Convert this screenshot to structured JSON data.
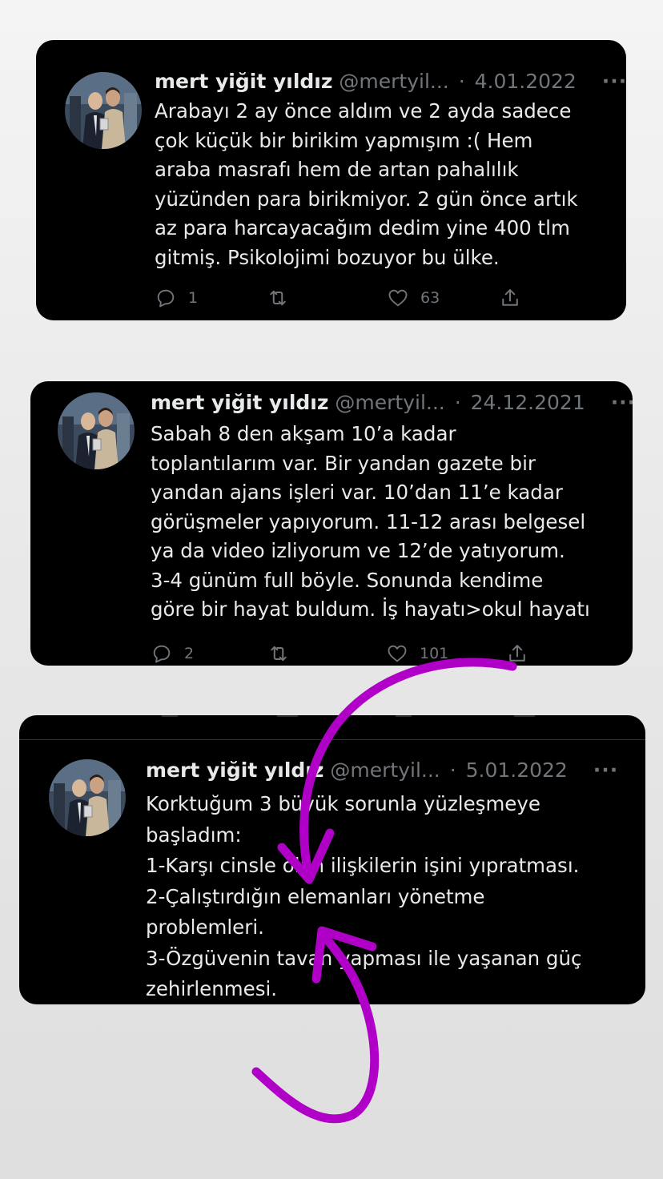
{
  "tweets": [
    {
      "name": "mert yiğit yıldız",
      "handle": "@mertyil...",
      "date": "4.01.2022",
      "more": "···",
      "lines": [
        "Arabayı 2 ay önce aldım ve 2 ayda sadece",
        "çok küçük bir birikim yapmışım :( Hem",
        "araba masrafı hem de artan pahalılık",
        "yüzünden para birikmiyor. 2 gün önce artık",
        "az para harcayacağım dedim yine 400 tlm",
        "gitmiş. Psikolojimi bozuyor bu ülke."
      ],
      "replies": "1",
      "likes": "63"
    },
    {
      "name": "mert yiğit yıldız",
      "handle": "@mertyil...",
      "date": "24.12.2021",
      "more": "···",
      "lines": [
        "Sabah 8 den akşam 10’a kadar",
        "toplantılarım var. Bir yandan gazete bir",
        "yandan ajans işleri var. 10’dan 11’e kadar",
        "görüşmeler yapıyorum. 11-12 arası belgesel",
        "ya da video izliyorum ve 12’de yatıyorum.",
        "3-4 günüm full böyle. Sonunda kendime",
        "göre bir hayat buldum. İş hayatı>okul hayatı"
      ],
      "replies": "2",
      "likes": "101"
    },
    {
      "name": "mert yiğit yıldız",
      "handle": "@mertyil...",
      "date": "5.01.2022",
      "more": "···",
      "lines": [
        "Korktuğum 3 büyük sorunla yüzleşmeye",
        "başladım:",
        "1-Karşı cinsle olan ilişkilerin işini yıpratması.",
        "2-Çalıştırdığın elemanları yönetme",
        "problemleri.",
        "3-Özgüvenin tavan yapması ile yaşanan güç",
        "zehirlenmesi."
      ]
    }
  ],
  "icons": {
    "reply": "speech-bubble",
    "retweet": "retweet-arrows",
    "like": "heart",
    "share": "share-upload"
  },
  "colors": {
    "card_bg": "#000000",
    "text": "#e7e9ea",
    "muted": "#71767b",
    "annotation": "#b000c8"
  }
}
